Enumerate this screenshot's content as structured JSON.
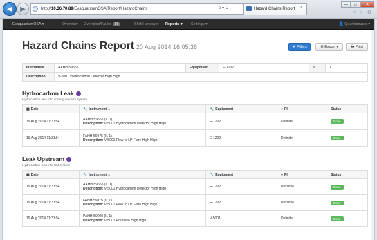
{
  "browser": {
    "address_host": "10.36.70.89",
    "address_rest": "/EvaquantumOSA/Report/HazardChains",
    "address_prefix": "http://",
    "tab_title": "Hazard Chains Report",
    "tab_close": "×",
    "addr_tools": "ρ ▾ C",
    "window_controls": [
      "—",
      "□",
      "✕"
    ],
    "tool_icons": [
      "⌂",
      "☆",
      "⚙"
    ]
  },
  "appbar": {
    "brand": "EvaquantumOSA ▾",
    "items": [
      {
        "label": "Overview"
      },
      {
        "label": "Overrides/Faults",
        "badge": "16"
      },
      {
        "label": "Shift Handover"
      },
      {
        "label": "Reports ▾",
        "active": true
      },
      {
        "label": "Settings ▾"
      }
    ],
    "user": "👤 Quantumuser ▾"
  },
  "page": {
    "title": "Hazard Chains Report",
    "date": "20 Aug 2014 16:05:38",
    "buttons": {
      "filters": "▼ Filters",
      "export": "⚙ Export ▾",
      "print": "🖶 Print"
    }
  },
  "info": {
    "instrument_label": "Instrument",
    "instrument_value": "AAHH-59655",
    "equipment_label": "Equipment",
    "equipment_value": "E-1202",
    "il_label": "IL",
    "il_value": "1",
    "description_label": "Description",
    "description_value": "V-5001 Hydrocarbon Detector High High"
  },
  "columns": {
    "date": "Date",
    "instrument": "Instrument",
    "equipment": "Equipment",
    "pi": "PI",
    "status": "Status"
  },
  "sections": [
    {
      "title": "Hydrocarbon Leak",
      "subtitle": "Hydrocarbon leak into cooling medium system",
      "rows": [
        {
          "date": "19 Aug 2014 11:31:54",
          "instrument": "AAHH-59655 (IL 1)",
          "description": "V-5001 Hydrocarbon Detector High High",
          "equipment": "E-1202",
          "pi": "Definite",
          "status": "Done"
        },
        {
          "date": "19 Aug 2014 11:31:54",
          "instrument": "FAHH-59875 (IL 1)",
          "description": "V-5001 Flow to LP Flare High High",
          "equipment": "E-1202",
          "pi": "Definite",
          "status": "Done"
        }
      ]
    },
    {
      "title": "Leak Upstream",
      "subtitle": "Hydrocarbon leak into CM system",
      "rows": [
        {
          "date": "19 Aug 2014 11:31:54",
          "instrument": "AAHH-59655 (IL 1)",
          "description": "V-5001 Hydrocarbon Detector High High",
          "equipment": "E-1202",
          "pi": "Possible",
          "status": "Done"
        },
        {
          "date": "19 Aug 2014 11:31:54",
          "instrument": "FAHH-59875 (IL 1)",
          "description": "V-5001 Flow to LP Flare High High",
          "equipment": "E-1202",
          "pi": "Possible",
          "status": "Done"
        },
        {
          "date": "19 Aug 2014 11:31:54",
          "instrument": "PAHH-59008 (IL 1)",
          "description": "V-5001 Pressure High High",
          "equipment": "V-5001",
          "pi": "Definite",
          "status": "Done"
        }
      ]
    }
  ],
  "labels": {
    "description_prefix": "Description:"
  },
  "colors": {
    "filters_button": "#2f7dd1",
    "status_done": "#5cb85c",
    "section_dot": "#6a3ea1",
    "appbar": "#2b2b2b"
  }
}
